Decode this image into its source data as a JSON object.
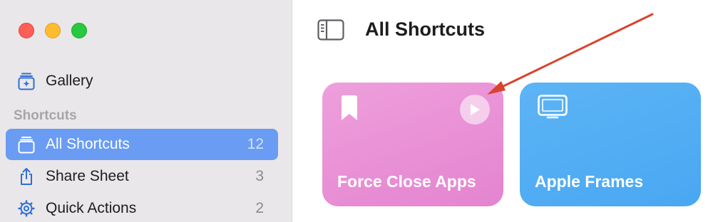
{
  "window": {
    "controls": [
      "close",
      "minimize",
      "zoom"
    ]
  },
  "sidebar": {
    "gallery": {
      "label": "Gallery",
      "icon": "gallery-icon"
    },
    "section_header": "Shortcuts",
    "items": [
      {
        "label": "All Shortcuts",
        "count": "12",
        "icon": "stack-icon",
        "selected": true
      },
      {
        "label": "Share Sheet",
        "count": "3",
        "icon": "share-icon",
        "selected": false
      },
      {
        "label": "Quick Actions",
        "count": "2",
        "icon": "gear-icon",
        "selected": false
      }
    ]
  },
  "main": {
    "title": "All Shortcuts",
    "cards": [
      {
        "label": "Force Close Apps",
        "color": "#e68fd6",
        "icon": "bookmark-icon"
      },
      {
        "label": "Apple Frames",
        "color": "#52aef4",
        "icon": "display-icon"
      }
    ]
  },
  "colors": {
    "accent": "#6a9cf3",
    "sidebar_bg": "#e9e7e9",
    "annotation_arrow": "#d9432f"
  }
}
